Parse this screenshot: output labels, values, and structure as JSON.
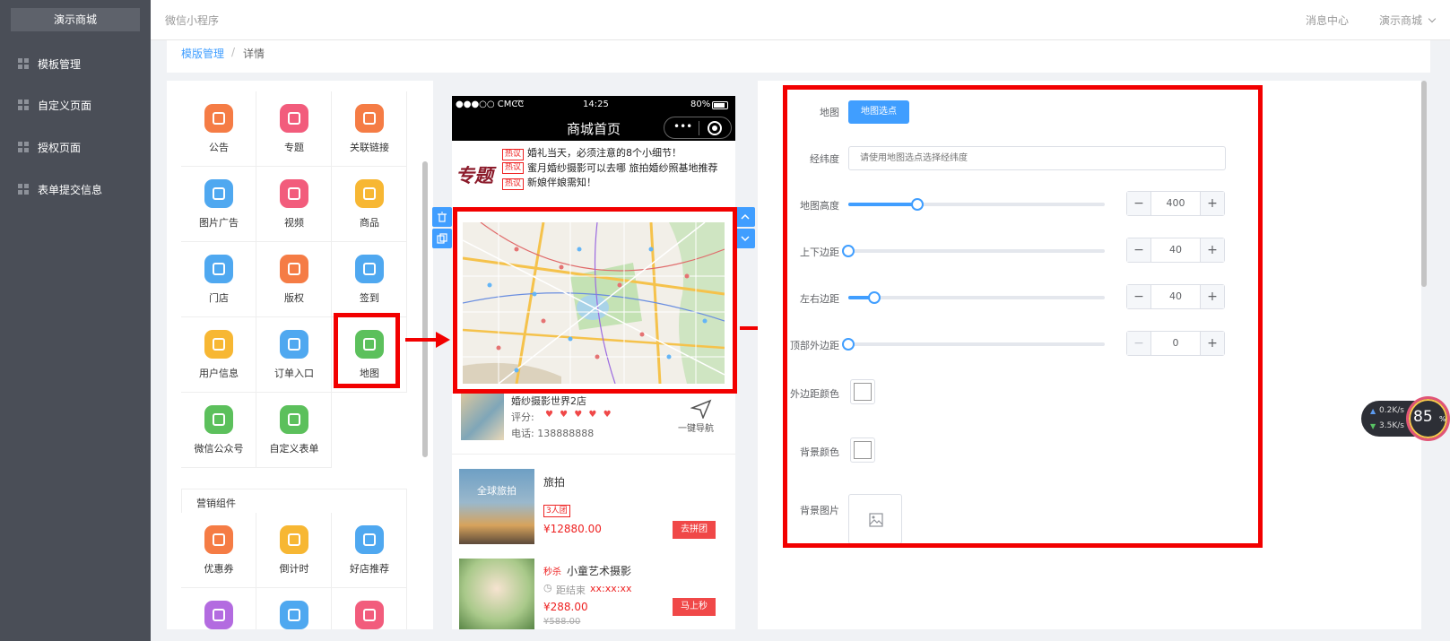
{
  "sidebar": {
    "logo": "演示商城",
    "items": [
      {
        "label": "模板管理"
      },
      {
        "label": "自定义页面"
      },
      {
        "label": "授权页面"
      },
      {
        "label": "表单提交信息"
      }
    ]
  },
  "topbar": {
    "brand": "微信小程序",
    "messages": "消息中心",
    "user": "演示商城"
  },
  "breadcrumb": {
    "parent": "模版管理",
    "separator": "/",
    "current": "详情"
  },
  "components": {
    "basic": [
      {
        "label": "公告",
        "icon": "speaker-icon",
        "color": "#f57c45"
      },
      {
        "label": "专题",
        "icon": "badge-icon",
        "color": "#f25c7c"
      },
      {
        "label": "关联链接",
        "icon": "link-icon",
        "color": "#f57c45"
      },
      {
        "label": "图片广告",
        "icon": "image-icon",
        "color": "#4fa8f0"
      },
      {
        "label": "视频",
        "icon": "video-icon",
        "color": "#f25c7c"
      },
      {
        "label": "商品",
        "icon": "bag-icon",
        "color": "#f7b733"
      },
      {
        "label": "门店",
        "icon": "store-icon",
        "color": "#4fa8f0"
      },
      {
        "label": "版权",
        "icon": "copyright-icon",
        "color": "#f57c45"
      },
      {
        "label": "签到",
        "icon": "pencil-icon",
        "color": "#4fa8f0"
      },
      {
        "label": "用户信息",
        "icon": "user-card-icon",
        "color": "#f7b733"
      },
      {
        "label": "订单入口",
        "icon": "clipboard-icon",
        "color": "#4fa8f0"
      },
      {
        "label": "地图",
        "icon": "map-pin-icon",
        "color": "#5cc05c"
      },
      {
        "label": "微信公众号",
        "icon": "wechat-icon",
        "color": "#5cc05c"
      },
      {
        "label": "自定义表单",
        "icon": "form-icon",
        "color": "#5cc05c"
      }
    ],
    "marketing_title": "营销组件",
    "marketing": [
      {
        "label": "优惠券",
        "icon": "coupon-icon",
        "color": "#f57c45"
      },
      {
        "label": "倒计时",
        "icon": "hourglass-icon",
        "color": "#f7b733"
      },
      {
        "label": "好店推荐",
        "icon": "shop-icon",
        "color": "#4fa8f0"
      },
      {
        "label": "",
        "icon": "group-icon",
        "color": "#b36be0"
      },
      {
        "label": "",
        "icon": "calendar-icon",
        "color": "#4fa8f0"
      },
      {
        "label": "",
        "icon": "alarm-icon",
        "color": "#f25c7c"
      }
    ]
  },
  "phone": {
    "carrier": "●●●○○ CMCC",
    "time": "14:25",
    "battery": "80%",
    "title": "商城首页",
    "topic_logo": "专题",
    "topics": [
      {
        "tag": "热议",
        "text": "婚礼当天，必须注意的8个小细节！"
      },
      {
        "tag": "热议",
        "text": "蜜月婚纱摄影可以去哪 旅拍婚纱照基地推荐"
      },
      {
        "tag": "热议",
        "text": "新娘伴娘需知！"
      }
    ],
    "shop": {
      "name": "婚纱摄影世界2店",
      "rating_label": "评分:",
      "hearts": "♥ ♥ ♥ ♥ ♥",
      "phone": "电话: 138888888",
      "nav": "一键导航"
    },
    "products": [
      {
        "image_text": "全球旅拍",
        "name": "旅拍",
        "badge": "3人团",
        "price": "¥12880.00",
        "button": "去拼团"
      },
      {
        "badge": "秒杀",
        "name": "小童艺术摄影",
        "countdown_label": "距结束",
        "countdown": "xx:xx:xx",
        "price": "¥288.00",
        "old_price": "¥588.00",
        "button": "马上秒"
      }
    ]
  },
  "properties": {
    "map_label": "地图",
    "map_button": "地图选点",
    "coord_label": "经纬度",
    "coord_placeholder": "请使用地图选点选择经纬度",
    "height_label": "地图高度",
    "height_value": "400",
    "height_fraction": 0.27,
    "vpad_label": "上下边距",
    "vpad_value": "40",
    "vpad_fraction": 0.0,
    "hpad_label": "左右边距",
    "hpad_value": "40",
    "hpad_fraction": 0.1,
    "topmargin_label": "顶部外边距",
    "topmargin_value": "0",
    "topmargin_fraction": 0.0,
    "margin_color_label": "外边距颜色",
    "bg_color_label": "背景颜色",
    "bg_image_label": "背景图片",
    "minus": "−",
    "plus": "+"
  },
  "speed_widget": {
    "up": "0.2K/s",
    "down": "3.5K/s",
    "percent": "85",
    "unit": "%"
  },
  "colors": {
    "accent": "#409eff",
    "highlight": "#f20000",
    "sidebar": "#4a4e57"
  }
}
